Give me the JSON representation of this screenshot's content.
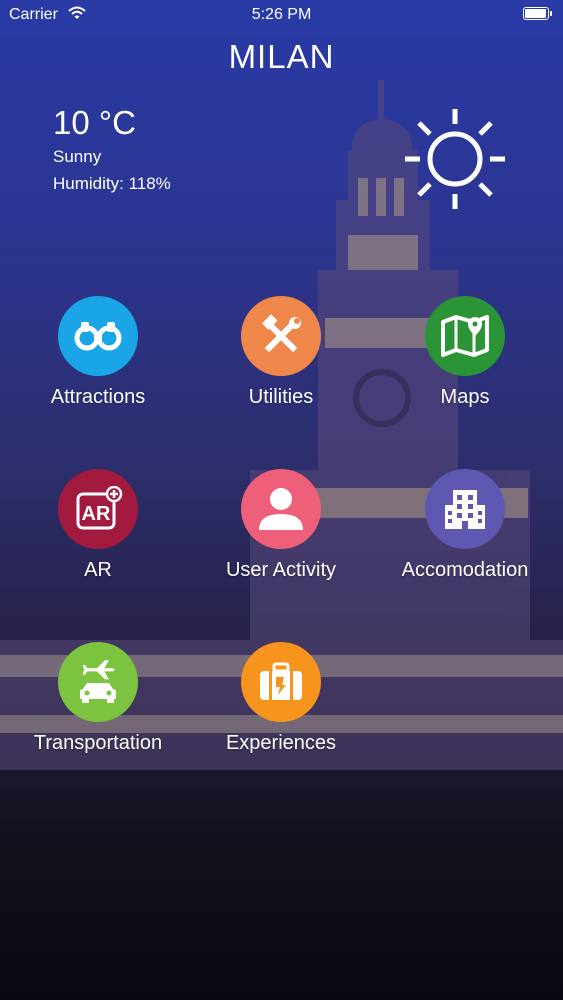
{
  "status_bar": {
    "carrier": "Carrier",
    "time": "5:26 PM",
    "battery_level": 1.0
  },
  "header": {
    "title": "MILAN"
  },
  "weather": {
    "temperature": "10 °C",
    "condition": "Sunny",
    "humidity": "Humidity: 118%",
    "icon": "sun-icon"
  },
  "colors": {
    "attractions": "#1aa6e6",
    "utilities": "#f0874a",
    "maps": "#2b9436",
    "ar": "#a31a3f",
    "user_activity": "#ee5f79",
    "accomodation": "#5f58b2",
    "transportation": "#7cc43f",
    "experiences": "#f7941d"
  },
  "menu": [
    {
      "label": "Attractions",
      "icon": "binoculars-icon"
    },
    {
      "label": "Utilities",
      "icon": "tools-icon"
    },
    {
      "label": "Maps",
      "icon": "map-icon"
    },
    {
      "label": "AR",
      "icon": "ar-icon"
    },
    {
      "label": "User Activity",
      "icon": "user-icon"
    },
    {
      "label": "Accomodation",
      "icon": "building-icon"
    },
    {
      "label": "Transportation",
      "icon": "plane-car-icon"
    },
    {
      "label": "Experiences",
      "icon": "suitcase-icon"
    }
  ]
}
